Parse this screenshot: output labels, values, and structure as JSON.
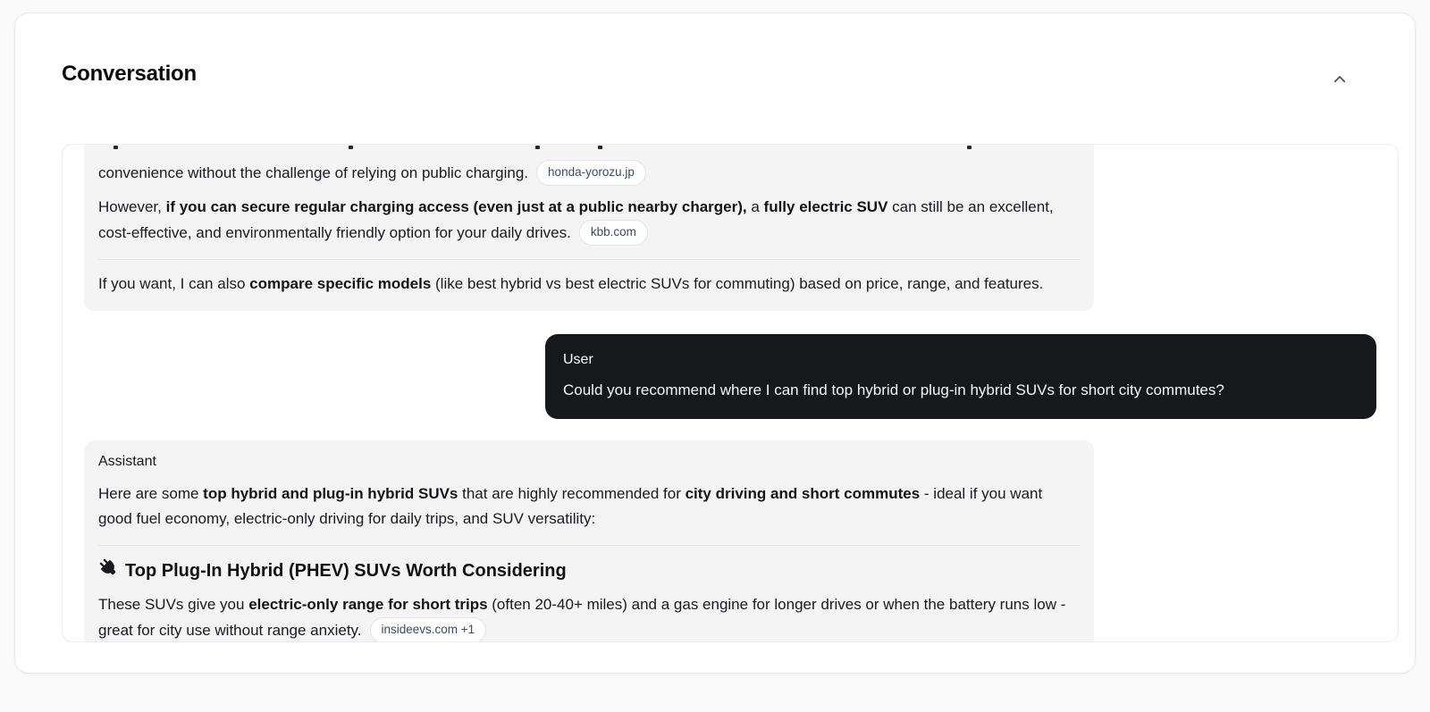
{
  "header": {
    "title": "Conversation",
    "collapse_icon": "chevron-up-icon"
  },
  "colors": {
    "page_background": "#fafafa",
    "card_background": "#ffffff",
    "assistant_bubble": "#f4f4f5",
    "user_bubble": "#17181b",
    "body_text": "#18181b",
    "badge_text": "#3e4a5e",
    "badge_border": "#e4e4e7",
    "divider": "#e4e4e7"
  },
  "conversation": {
    "messages": [
      {
        "role": "assistant",
        "clipped_top": true,
        "label": null,
        "blocks": [
          {
            "type": "p",
            "runs": [
              {
                "text": "convenience without the challenge of relying on public charging."
              }
            ],
            "badge": "honda-yorozu.jp"
          },
          {
            "type": "p",
            "runs": [
              {
                "text": "However, "
              },
              {
                "text": "if you can secure regular charging access (even just at a public nearby charger),",
                "bold": true
              },
              {
                "text": " a "
              },
              {
                "text": "fully electric SUV",
                "bold": true
              },
              {
                "text": " can still be an excellent, cost-effective, and environmentally friendly option for your daily drives."
              }
            ],
            "badge": "kbb.com"
          },
          {
            "type": "divider"
          },
          {
            "type": "p",
            "runs": [
              {
                "text": "If you want, I can also "
              },
              {
                "text": "compare specific models",
                "bold": true
              },
              {
                "text": " (like best hybrid vs best electric SUVs for commuting) based on price, range, and features."
              }
            ]
          }
        ]
      },
      {
        "role": "user",
        "label": "User",
        "text": "Could you recommend where I can find top hybrid or plug-in hybrid SUVs for short city commutes?"
      },
      {
        "role": "assistant",
        "label": "Assistant",
        "blocks": [
          {
            "type": "p",
            "runs": [
              {
                "text": "Here are some "
              },
              {
                "text": "top hybrid and plug-in hybrid SUVs",
                "bold": true
              },
              {
                "text": " that are highly recommended for "
              },
              {
                "text": "city driving and short commutes",
                "bold": true
              },
              {
                "text": " - ideal if you want good fuel economy, electric-only driving for daily trips, and SUV versatility:"
              }
            ]
          },
          {
            "type": "divider"
          },
          {
            "type": "heading",
            "icon": "plug-icon",
            "text": "Top Plug-In Hybrid (PHEV) SUVs Worth Considering"
          },
          {
            "type": "p",
            "runs": [
              {
                "text": "These SUVs give you "
              },
              {
                "text": "electric-only range for short trips",
                "bold": true
              },
              {
                "text": " (often 20-40+ miles) and a gas engine for longer drives or when the battery runs low - great for city use without range anxiety."
              }
            ],
            "badge": "insideevs.com +1"
          }
        ]
      }
    ]
  }
}
